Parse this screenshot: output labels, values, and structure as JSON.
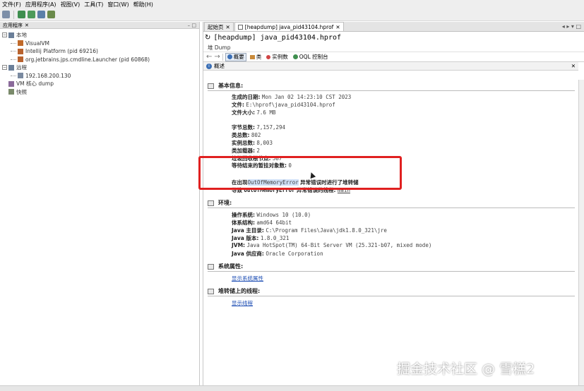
{
  "menubar": {
    "items": [
      "文件(F)",
      "应用程序(A)",
      "视图(V)",
      "工具(T)",
      "窗口(W)",
      "帮助(H)"
    ]
  },
  "toolbar": {
    "icons": [
      "open-file-icon",
      "add-jmx-icon",
      "heap-dump-icon",
      "thread-dump-icon",
      "snapshot-icon"
    ]
  },
  "left_panel": {
    "tab_label": "应用程序",
    "tab_close": "✕",
    "window_controls": "– □",
    "tree": [
      {
        "toggle": "−",
        "label": "本地",
        "indent": 0,
        "icon": "local-host-icon"
      },
      {
        "toggle": "",
        "label": "VisualVM",
        "indent": 1,
        "icon": "visualvm-icon"
      },
      {
        "toggle": "",
        "label": "Intellij Platform (pid 69216)",
        "indent": 1,
        "icon": "java-app-icon"
      },
      {
        "toggle": "",
        "label": "org.jetbrains.jps.cmdline.Launcher (pid 60868)",
        "indent": 1,
        "icon": "java-app-icon"
      },
      {
        "toggle": "−",
        "label": "远程",
        "indent": 0,
        "icon": "remote-host-icon"
      },
      {
        "toggle": "",
        "label": "192.168.200.130",
        "indent": 1,
        "icon": "remote-machine-icon"
      },
      {
        "toggle": "",
        "label": "VM 核心 dump",
        "indent": 0,
        "icon": "core-dump-icon"
      },
      {
        "toggle": "",
        "label": "快照",
        "indent": 0,
        "icon": "snapshot-icon"
      }
    ]
  },
  "right_panel": {
    "tabs": [
      {
        "label": "起始页",
        "close": "✕",
        "active": false
      },
      {
        "label": "[heapdump] java_pid43104.hprof",
        "close": "✕",
        "active": true
      }
    ],
    "tabbar_controls": "◂ ▸ ▾ □",
    "dump_title": "[heapdump] java_pid43104.hprof",
    "dump_subtitle": "堆 Dump",
    "view_toolbar": {
      "back": "←",
      "forward": "→",
      "items": [
        {
          "label": "概要",
          "active": true,
          "icon": "summary-icon"
        },
        {
          "label": "类",
          "active": false,
          "icon": "classes-icon"
        },
        {
          "label": "实例数",
          "active": false,
          "icon": "instances-icon"
        },
        {
          "label": "OQL 控制台",
          "active": false,
          "icon": "oql-console-icon"
        }
      ]
    },
    "summary_header": {
      "label": "概述",
      "close": "✕"
    },
    "basic_info": {
      "heading": "基本信息:",
      "date_label": "生成的日期:",
      "date_value": "Mon Jan 02 14:23:10 CST 2023",
      "file_label": "文件:",
      "file_value": "E:\\hprof\\java_pid43104.hprof",
      "size_label": "文件大小:",
      "size_value": "7.6 MB",
      "bytes_label": "字节总数:",
      "bytes_value": "7,157,294",
      "classes_label": "类总数:",
      "classes_value": "802",
      "instances_label": "实例总数:",
      "instances_value": "8,003",
      "loaders_label": "类加载器:",
      "loaders_value": "2",
      "gc_roots_label": "垃圾回收根节点:",
      "gc_roots_value": "587",
      "pending_label": "等待结束的暂挂对象数:",
      "pending_value": "0",
      "oom_prefix": "在出现",
      "oom_class": "OutOfMemoryError",
      "oom_suffix": "异常错误时进行了堆转储",
      "thread_prefix": "导致",
      "thread_class": "OutOfMemoryError",
      "thread_suffix": "异常错误的线程:",
      "thread_link": "main"
    },
    "environment": {
      "heading": "环境:",
      "os_label": "操作系统:",
      "os_value": "Windows 10 (10.0)",
      "arch_label": "体系结构:",
      "arch_value": "amd64 64bit",
      "home_label": "Java 主目录:",
      "home_value": "C:\\Program Files\\Java\\jdk1.8.0_321\\jre",
      "version_label": "Java 版本:",
      "version_value": "1.8.0_321",
      "jvm_label": "JVM:",
      "jvm_value": "Java HotSpot(TM) 64-Bit Server VM (25.321-b07, mixed mode)",
      "vendor_label": "Java 供应商:",
      "vendor_value": "Oracle Corporation"
    },
    "system_properties": {
      "heading": "系统属性:",
      "link": "显示系统属性"
    },
    "threads": {
      "heading": "堆转储上的线程:",
      "link": "显示线程"
    }
  },
  "watermark": "掘金技术社区 @ 雪糕2",
  "colors": {
    "highlight_box": "#e02020",
    "link": "#1f4fb4",
    "selection": "#cfe0f7"
  }
}
